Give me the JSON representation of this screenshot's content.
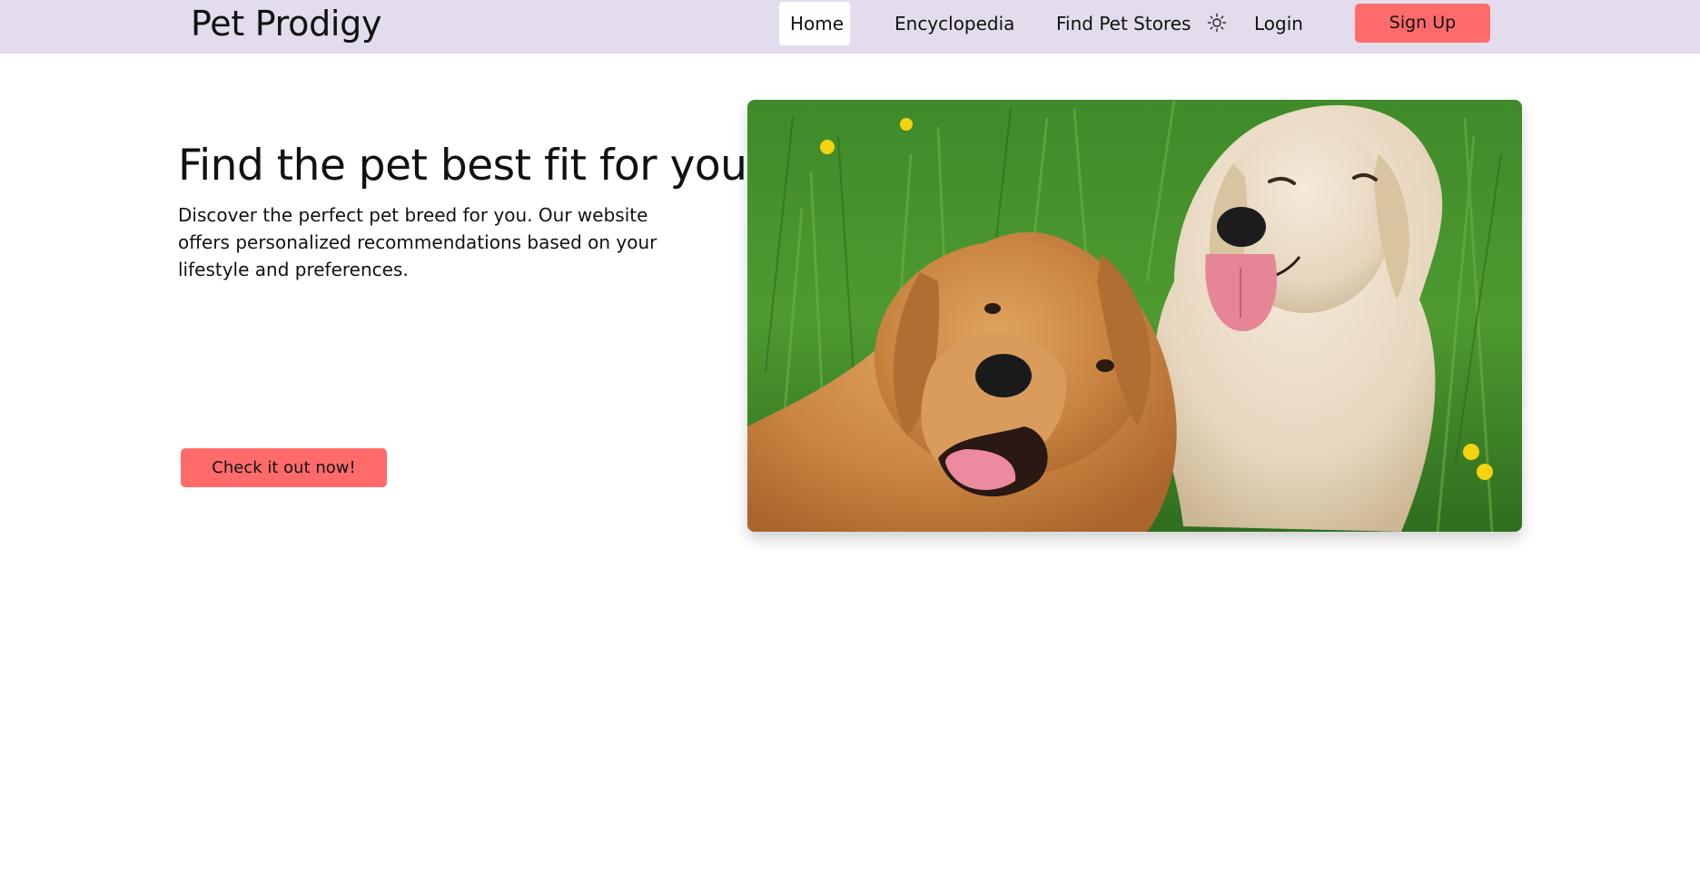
{
  "header": {
    "brand": "Pet Prodigy",
    "nav": {
      "home": "Home",
      "encyclopedia": "Encyclopedia",
      "find_stores": "Find Pet Stores",
      "theme_icon": "sun-icon",
      "login": "Login",
      "signup": "Sign Up"
    }
  },
  "hero": {
    "title": "Find the pet best fit for you",
    "description": "Discover the perfect pet breed for you. Our website offers personalized recommendations based on your lifestyle and preferences.",
    "cta": "Check it out now!",
    "image": "two-golden-retrievers-in-grass"
  },
  "colors": {
    "header_bg": "#e3dcec",
    "accent": "#ff6b6b",
    "active_nav_bg": "#ffffff"
  }
}
